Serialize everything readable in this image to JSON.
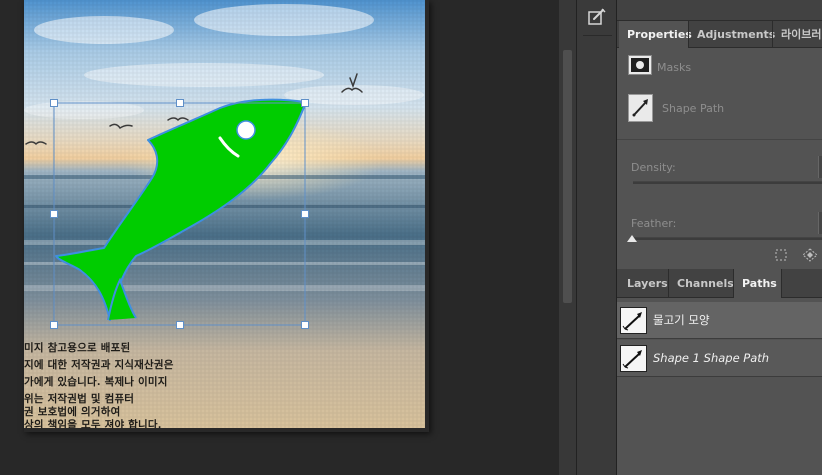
{
  "canvas": {
    "caption_lines": [
      "미지 참고용으로 배포된",
      "지에 대한 저작권과 지식재산권은",
      "가에게 있습니다. 복제나 이미지",
      "위는 저작권법 및 컴퓨터",
      "권 보호법에 의거하여",
      "상의 책임을 모두 져야 합니다."
    ]
  },
  "properties_panel": {
    "tabs": [
      "Properties",
      "Adjustments",
      "라이브러리"
    ],
    "active_tab": "Properties",
    "masks_label": "Masks",
    "shape_path_label": "Shape Path",
    "density_label": "Density:",
    "feather_label": "Feather:"
  },
  "layers_panel": {
    "tabs": [
      "Layers",
      "Channels",
      "Paths"
    ],
    "active_tab": "Paths",
    "paths": [
      {
        "name": "물고기 모양",
        "italic": false,
        "selected": true
      },
      {
        "name": "Shape 1 Shape Path",
        "italic": true,
        "selected": false
      }
    ]
  },
  "colors": {
    "fish_fill": "#00cc00",
    "fish_stroke": "#3f8fe0",
    "panel_bg": "#535353",
    "tab_bar_bg": "#424242",
    "selected_row": "#646464"
  },
  "icons": {
    "tool_strip": "edit-properties-icon",
    "masks": "pixel-mask-icon",
    "shape_path": "pen-path-icon",
    "select_mask": "marquee-select-icon",
    "load_selection": "diamond-selection-icon",
    "path_thumb": "fish-path-icon"
  }
}
